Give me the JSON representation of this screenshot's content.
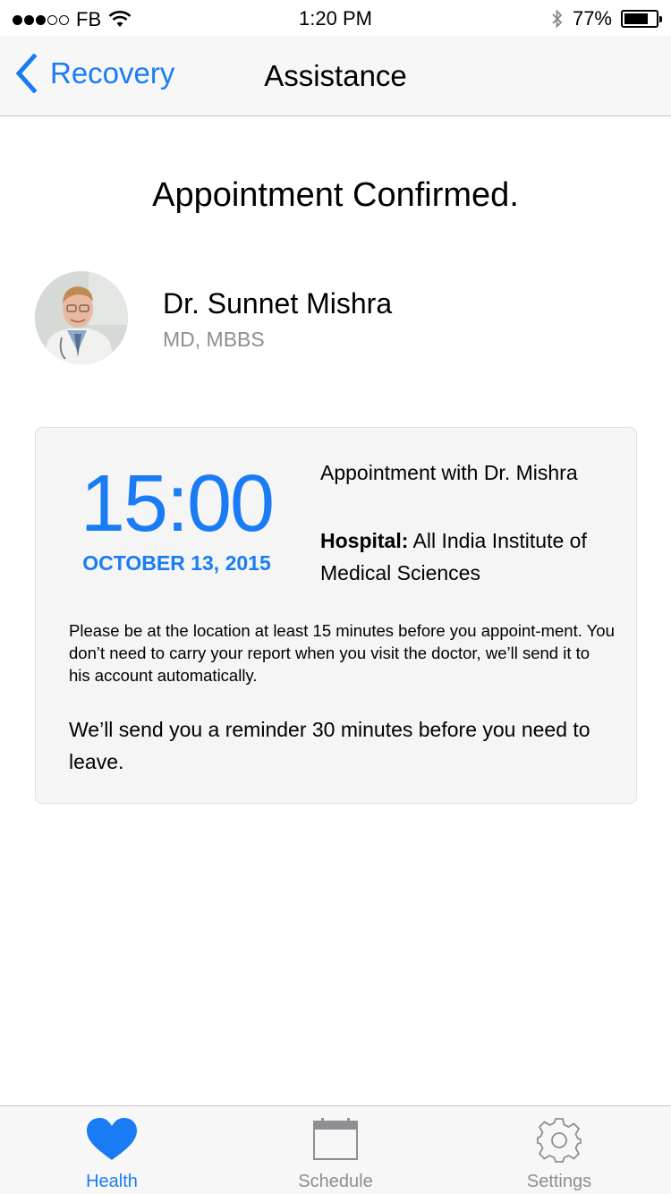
{
  "status_bar": {
    "carrier": "FB",
    "time": "1:20 PM",
    "battery_percent": "77%",
    "battery_level": 0.77
  },
  "nav": {
    "back_label": "Recovery",
    "title": "Assistance"
  },
  "heading": "Appointment Confirmed.",
  "doctor": {
    "name": "Dr. Sunnet Mishra",
    "credentials": "MD, MBBS"
  },
  "appointment": {
    "time": "15:00",
    "date": "OCTOBER 13, 2015",
    "with": "Appointment with Dr. Mishra",
    "hospital_label": "Hospital:",
    "hospital_name": "All India Institute of Medical Sciences",
    "note": "Please be at the location at least 15 minutes before you appoint-ment. You don’t need to carry your report when you visit the doctor, we’ll send it to his account automatically.",
    "reminder": "We’ll send you a reminder 30 minutes before you need to leave."
  },
  "tabs": [
    {
      "label": "Health",
      "icon": "heart-icon",
      "active": true
    },
    {
      "label": "Schedule",
      "icon": "calendar-icon",
      "active": false
    },
    {
      "label": "Settings",
      "icon": "gear-icon",
      "active": false
    }
  ],
  "colors": {
    "accent": "#1a7cf4",
    "secondary_text": "#8e8e93",
    "card_background": "#f5f5f6"
  }
}
